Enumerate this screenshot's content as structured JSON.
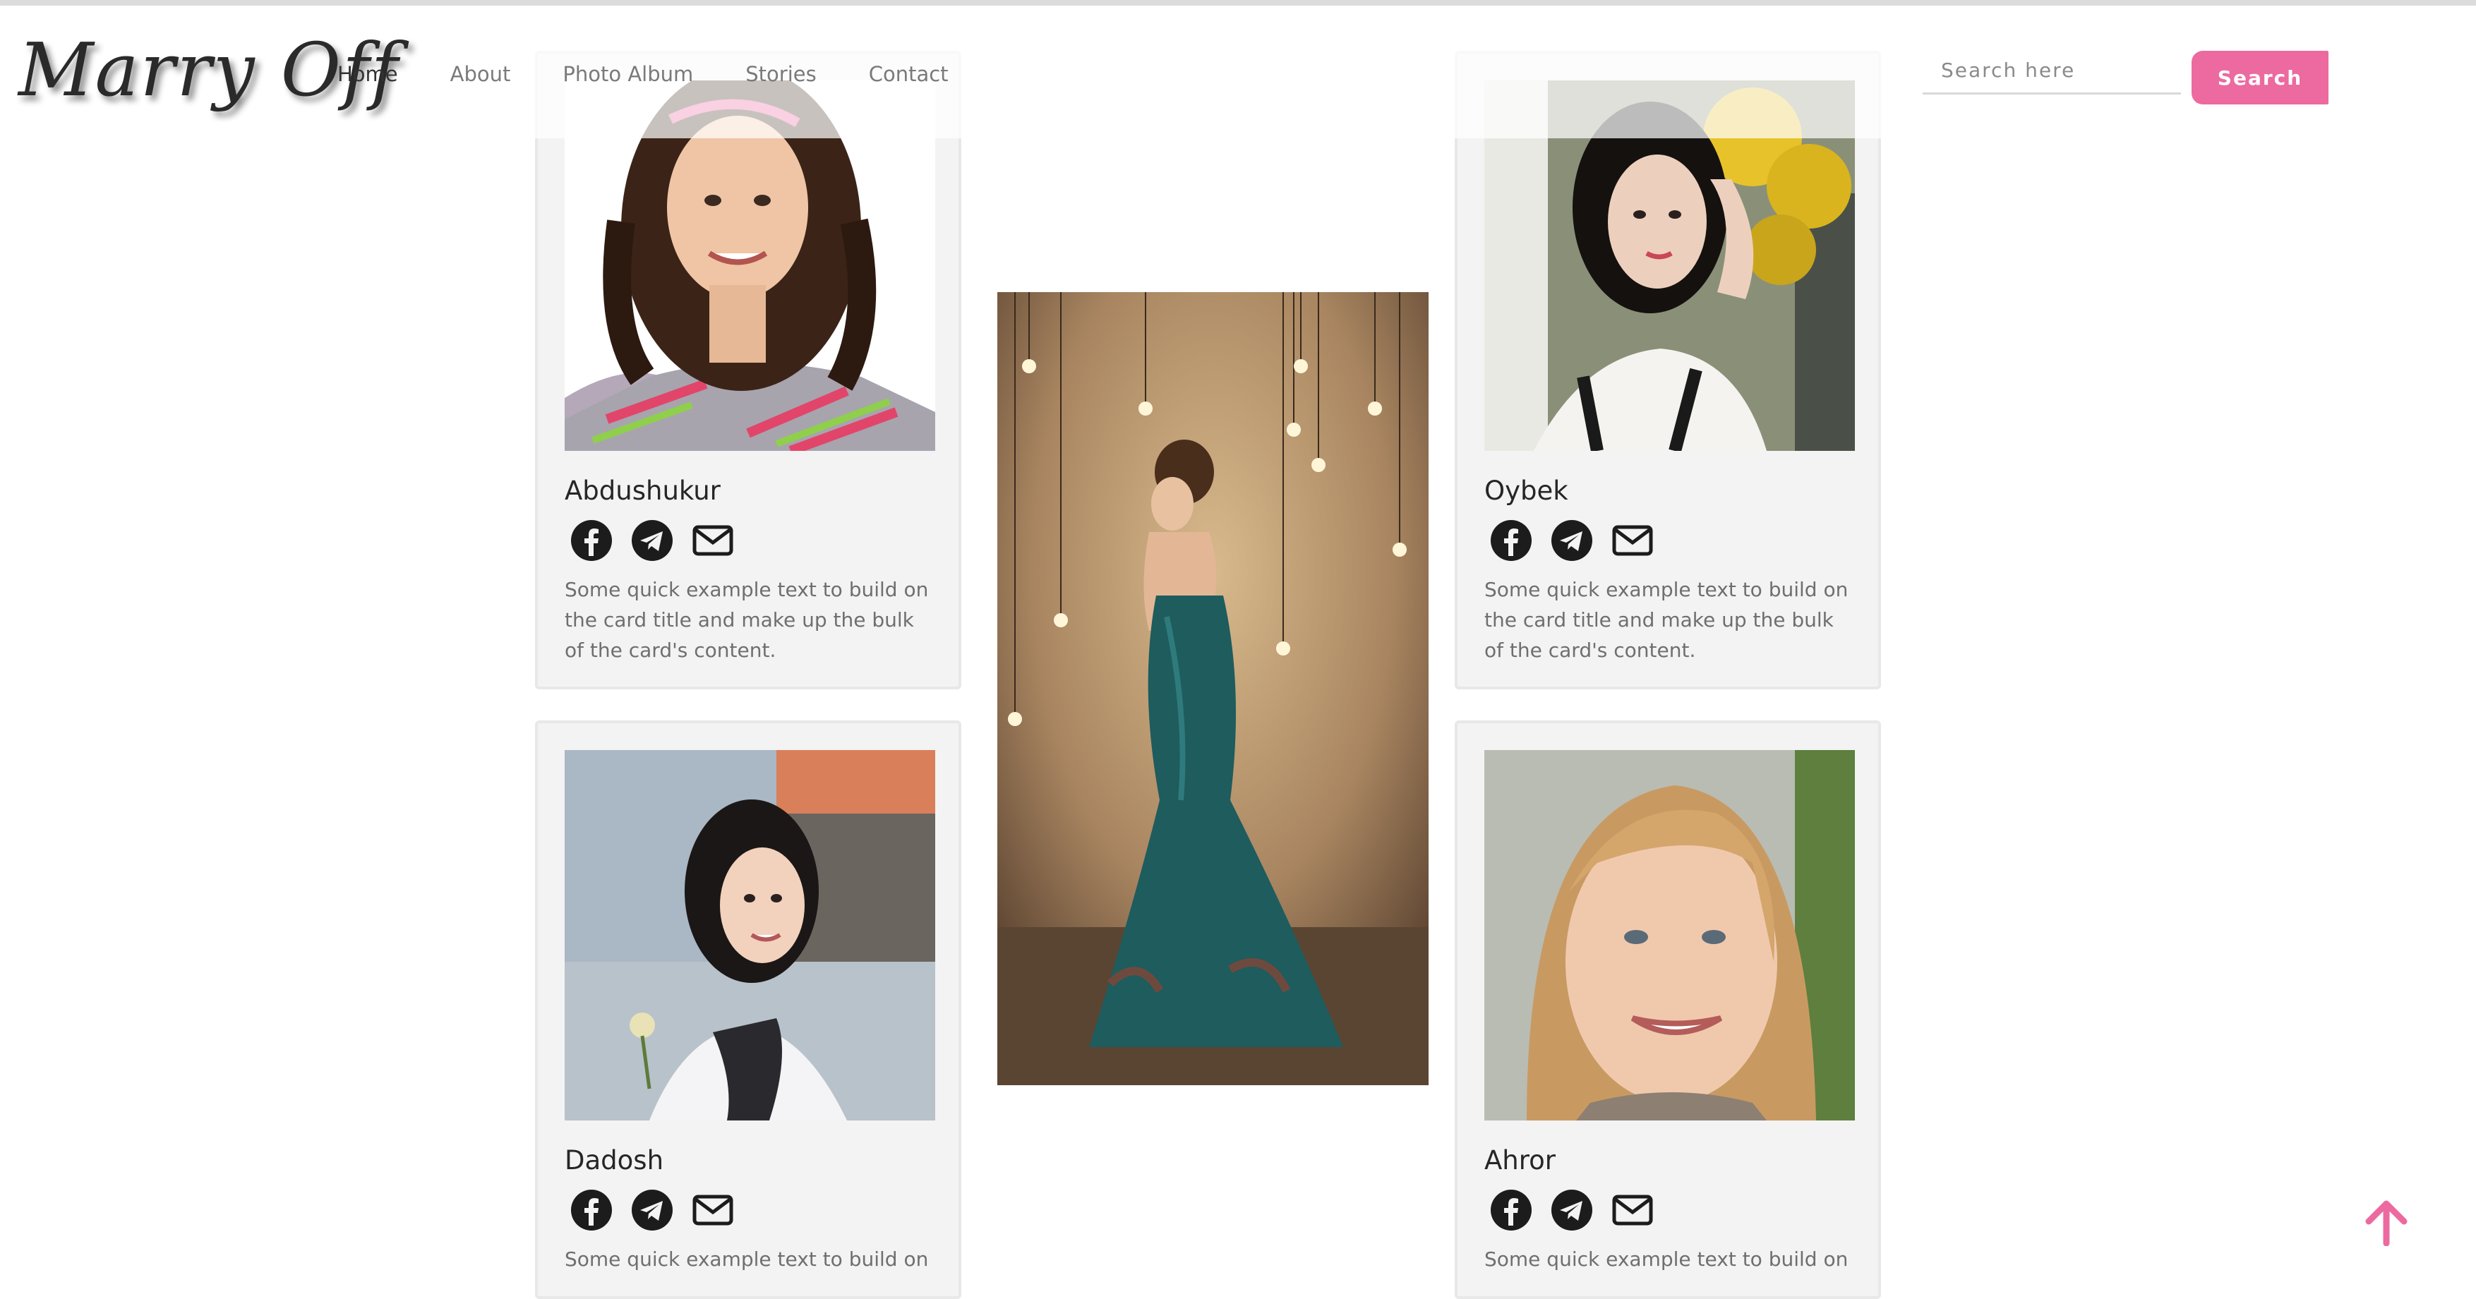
{
  "header": {
    "brand": "Marry Off",
    "nav": [
      "Home",
      "About",
      "Photo Album",
      "Stories",
      "Contact"
    ],
    "active_nav": "Home",
    "search_placeholder": "Search here",
    "search_button": "Search"
  },
  "cards": [
    {
      "name": "Abdushukur",
      "text": "Some quick example text to build on the card title and make up the bulk of the card's content."
    },
    {
      "name": "Oybek",
      "text": "Some quick example text to build on the card title and make up the bulk of the card's content."
    },
    {
      "name": "Dadosh",
      "text": "Some quick example text to build on"
    },
    {
      "name": "Ahror",
      "text": "Some quick example text to build on"
    }
  ],
  "icons": [
    "facebook-icon",
    "telegram-icon",
    "envelope-icon",
    "arrow-up-icon"
  ],
  "colors": {
    "accent": "#ec6aa0",
    "card_bg": "#f3f3f3",
    "icon": "#1c1c1c"
  }
}
